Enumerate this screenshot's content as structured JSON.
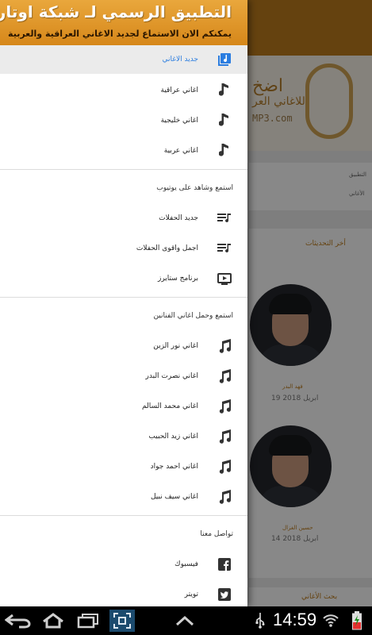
{
  "background_app": {
    "logo_line1": "اضخ",
    "logo_line2": "للاغاني العر",
    "logo_site": "MP3.com",
    "row1": "التطبيق",
    "row2": "الأغاني",
    "section_title": "أخر التحديثات",
    "cards": [
      {
        "name": "فهد البدر",
        "date": "19 ابريل 2018"
      },
      {
        "name": "حسين الغزال",
        "date": "14 ابريل 2018"
      }
    ],
    "search_label": "بحث الأغاني"
  },
  "drawer": {
    "header_title": "التطبيق الرسمي لـ شبكة اوتار",
    "header_subtitle": "يمكنكم الان الاستماع لجديد الاغاني العراقية والعربية",
    "accent_color": "#e5a136",
    "active_color": "#2b7de0",
    "songs_section": [
      {
        "label": "جديد الاغاني",
        "icon": "music-library-icon",
        "active": true
      },
      {
        "label": "اغاني عراقية",
        "icon": "music-note-icon",
        "active": false
      },
      {
        "label": "اغاني خليجية",
        "icon": "music-note-icon",
        "active": false
      },
      {
        "label": "اغاني عربية",
        "icon": "music-note-icon",
        "active": false
      }
    ],
    "youtube_section": {
      "title": "استمع وشاهد على يوتيوب",
      "items": [
        {
          "label": "جديد الحفلات",
          "icon": "playlist-icon"
        },
        {
          "label": "اجمل واقوى الحفلات",
          "icon": "playlist-icon"
        },
        {
          "label": "برنامج ستايرز",
          "icon": "video-icon"
        }
      ]
    },
    "artists_section": {
      "title": "استمع وحمل اغاني الفنانين",
      "items": [
        {
          "label": "اغاني نور الزين",
          "icon": "double-note-icon"
        },
        {
          "label": "اغاني نصرت البدر",
          "icon": "double-note-icon"
        },
        {
          "label": "اغاني محمد السالم",
          "icon": "double-note-icon"
        },
        {
          "label": "اغاني زيد الحبيب",
          "icon": "double-note-icon"
        },
        {
          "label": "اغاني احمد جواد",
          "icon": "double-note-icon"
        },
        {
          "label": "اغاني سيف نبيل",
          "icon": "double-note-icon"
        }
      ]
    },
    "contact_section": {
      "title": "تواصل معنا",
      "items": [
        {
          "label": "فيسبوك",
          "icon": "facebook-icon"
        },
        {
          "label": "تويتر",
          "icon": "twitter-icon"
        }
      ]
    }
  },
  "navbar": {
    "time": "14:59",
    "buttons": [
      "back-icon",
      "home-icon",
      "recent-apps-icon",
      "screenshot-icon",
      "menu-up-icon"
    ],
    "status_icons": [
      "usb-icon",
      "wifi-icon",
      "battery-charging-icon"
    ]
  }
}
